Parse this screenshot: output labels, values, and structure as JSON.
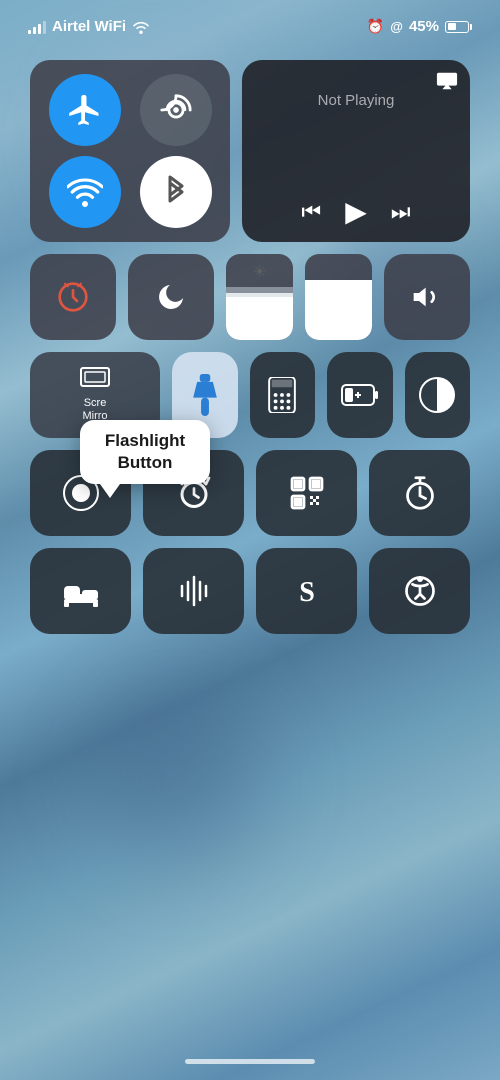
{
  "statusBar": {
    "carrier": "Airtel WiFi",
    "battery": "45%",
    "alarmIcon": "⏰",
    "lockIcon": "@"
  },
  "nowPlaying": {
    "title": "Not Playing"
  },
  "screenMirror": {
    "text": "Scre\nMirro"
  },
  "tooltip": {
    "text": "Flashlight\nButton"
  },
  "buttons": {
    "airplaneMode": "airplane-mode",
    "cellular": "cellular",
    "wifi": "wifi",
    "bluetooth": "bluetooth",
    "portraitLock": "portrait-lock",
    "darkMode": "dark-mode",
    "screenMirror": "Screen Mirror",
    "flashlight": "flashlight",
    "calculator": "calculator",
    "lowPower": "low-power",
    "grayscale": "grayscale",
    "record": "record",
    "alarm": "alarm",
    "qrCode": "qr-code",
    "timer": "timer",
    "sleep": "sleep",
    "soundrecog": "sound-recognition",
    "shazam": "shazam",
    "accessibility": "accessibility"
  }
}
